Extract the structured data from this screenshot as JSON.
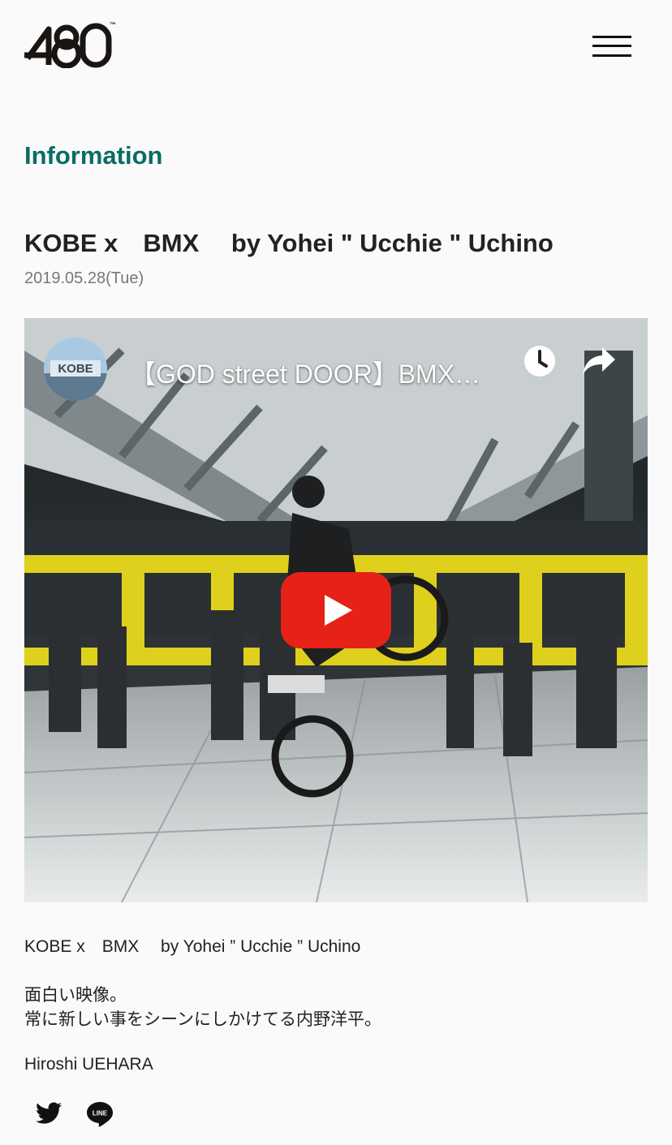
{
  "header": {
    "logo_text": "480",
    "logo_tm": "™",
    "menu_icon": "hamburger-menu-icon"
  },
  "section": {
    "title": "Information"
  },
  "post": {
    "title": "KOBE x　BMX　 by Yohei \" Ucchie \" Uchino",
    "date": "2019.05.28(Tue)",
    "video": {
      "title": "【GOD street DOOR】BMX…",
      "channel_avatar_text": "KOBE",
      "overlay_text": "DDOO",
      "icons": [
        "watch-later-icon",
        "share-icon",
        "youtube-play-icon"
      ],
      "colors": {
        "play_red": "#e62117",
        "overlay_yellow": "#f2e21a"
      }
    },
    "body": {
      "line1": "KOBE x　BMX　 by Yohei ” Ucchie ” Uchino",
      "line2": "面白い映像。",
      "line3": "常に新しい事をシーンにしかけてる内野洋平。",
      "author": "Hiroshi UEHARA"
    }
  },
  "share_buttons": [
    {
      "icon": "twitter-icon"
    },
    {
      "icon": "line-icon",
      "label": "LINE"
    }
  ],
  "colors": {
    "accent": "#0a6d64",
    "text": "#222222",
    "date": "#777777"
  }
}
